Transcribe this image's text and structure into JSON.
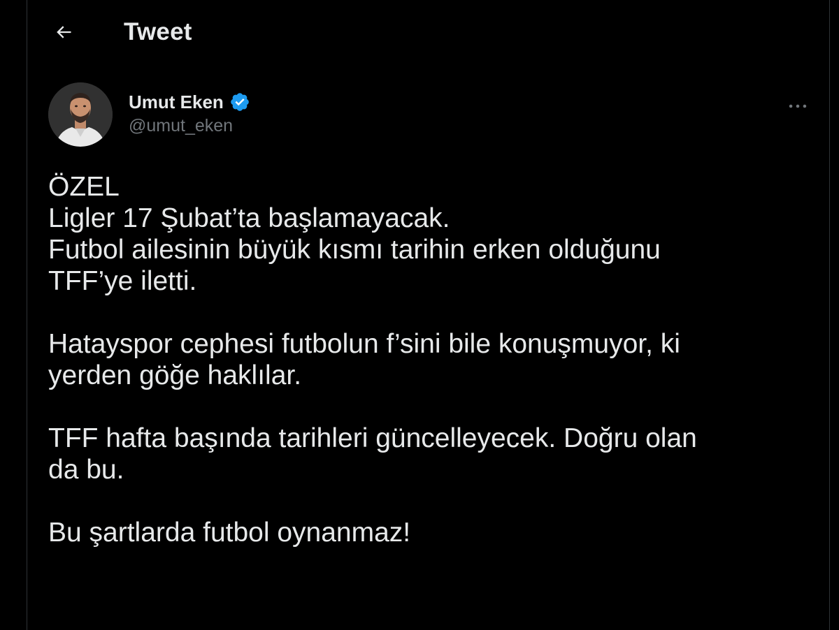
{
  "header": {
    "back_icon": "arrow-left-icon",
    "title": "Tweet"
  },
  "author": {
    "display_name": "Umut Eken",
    "handle": "@umut_eken",
    "verified_icon": "verified-badge-icon",
    "verified_color": "#1d9bf0",
    "more_icon": "more-horizontal-icon"
  },
  "tweet": {
    "paragraphs": [
      [
        "ÖZEL",
        "Ligler 17 Şubat’ta başlamayacak.",
        "Futbol ailesinin büyük kısmı tarihin erken olduğunu",
        "TFF’ye iletti."
      ],
      [
        "Hatayspor cephesi futbolun f’sini bile konuşmuyor, ki",
        "yerden göğe haklılar."
      ],
      [
        "TFF hafta başında tarihleri güncelleyecek. Doğru olan",
        "da bu."
      ],
      [
        "Bu şartlarda futbol oynanmaz!"
      ]
    ]
  },
  "colors": {
    "background": "#000000",
    "text_primary": "#e7e9ea",
    "text_secondary": "#71767b",
    "border": "#2f3336",
    "accent": "#1d9bf0"
  }
}
